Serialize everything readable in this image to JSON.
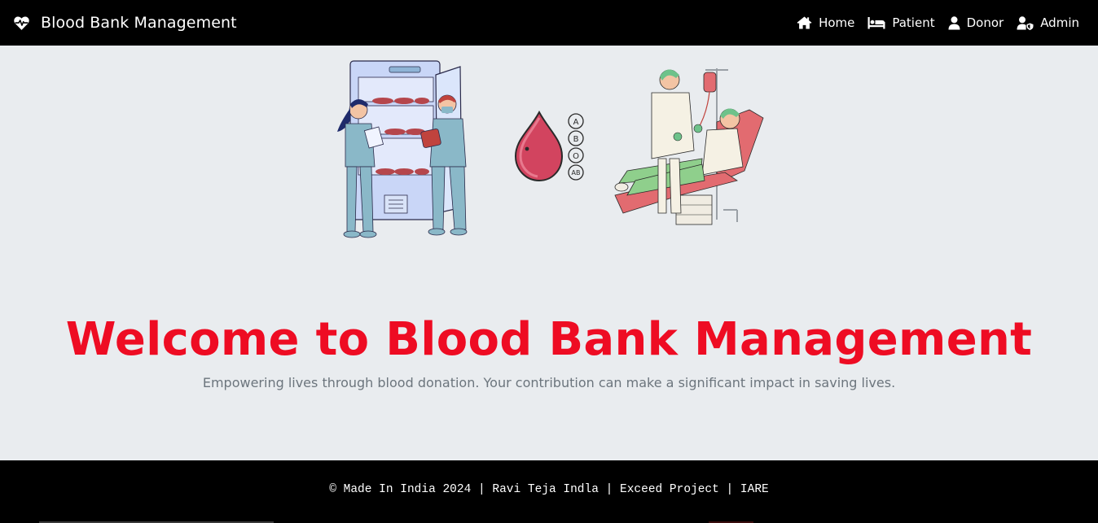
{
  "navbar": {
    "brand": "Blood Bank Management",
    "brand_icon": "heart-pulse-icon",
    "links": [
      {
        "label": "Home",
        "icon": "home-icon"
      },
      {
        "label": "Patient",
        "icon": "bed-icon"
      },
      {
        "label": "Donor",
        "icon": "user-icon"
      },
      {
        "label": "Admin",
        "icon": "user-shield-icon"
      }
    ]
  },
  "hero": {
    "blood_types": [
      "A",
      "B",
      "O",
      "AB"
    ],
    "title": "Welcome to Blood Bank Management",
    "subtitle": "Empowering lives through blood donation. Your contribution can make a significant impact in saving lives."
  },
  "footer": {
    "text": "© Made In India 2024 | Ravi Teja Indla | Exceed Project | IARE"
  },
  "colors": {
    "navbar_bg": "#000000",
    "page_bg": "#e9ecef",
    "title_red": "#ee0c23",
    "subtitle_gray": "#6c757d"
  }
}
